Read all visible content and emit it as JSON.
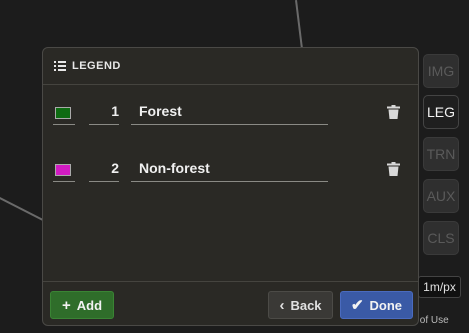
{
  "panel": {
    "title": "LEGEND",
    "items": [
      {
        "color": "#0e6b12",
        "number": "1",
        "name": "Forest"
      },
      {
        "color": "#d11bc2",
        "number": "2",
        "name": "Non-forest"
      }
    ],
    "add_label": "Add",
    "back_label": "Back",
    "done_label": "Done"
  },
  "toolbar": {
    "items": [
      "IMG",
      "LEG",
      "TRN",
      "AUX",
      "CLS"
    ],
    "active": "LEG"
  },
  "scale": {
    "label": "1m/px"
  },
  "footer": {
    "terms": "s of Use"
  },
  "colors": {
    "add": "#2f6d2a",
    "done": "#3a5aa6",
    "panel_bg": "#2a2925"
  }
}
